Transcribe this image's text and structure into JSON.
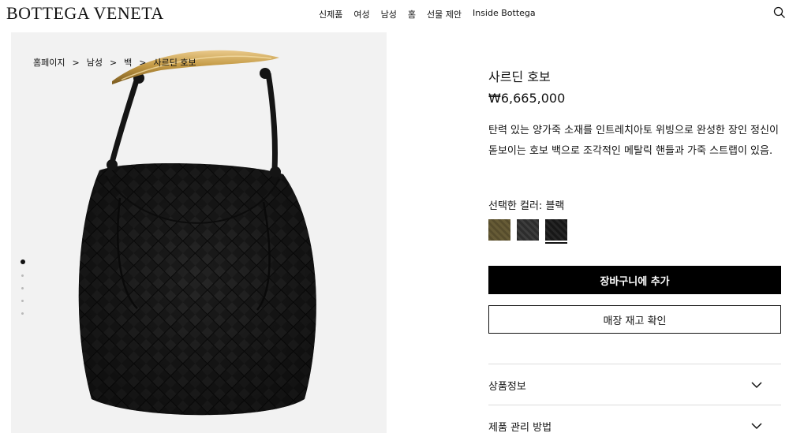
{
  "header": {
    "logo": "BOTTEGA VENETA",
    "nav": [
      "신제품",
      "여성",
      "남성",
      "홈",
      "선물 제안",
      "Inside Bottega"
    ],
    "search_icon": "search-icon"
  },
  "breadcrumb": [
    "홈페이지",
    "남성",
    "백",
    "사르딘 호보"
  ],
  "breadcrumb_separator": ">",
  "gallery": {
    "image_count": 5,
    "active_index": 0
  },
  "product": {
    "title": "사르딘 호보",
    "price": "₩6,665,000",
    "description": "탄력 있는 양가죽 소재를 인트레치아토 위빙으로 완성한 장인 정신이 돋보이는 호보 백으로 조각적인 메탈릭 핸들과 가죽 스트랩이 있음.",
    "color_label": "선택한 컬러: 블랙",
    "swatches": [
      {
        "name": "olive",
        "color": "#9a9170"
      },
      {
        "name": "dark-grey",
        "color": "#333333"
      },
      {
        "name": "black",
        "color": "#1c1c1c",
        "selected": true
      }
    ],
    "add_to_cart": "장바구니에 추가",
    "check_stock": "매장 재고 확인"
  },
  "accordion": [
    "상품정보",
    "제품 관리 방법"
  ],
  "colors": {
    "accent": "#000000",
    "panel_bg": "#f2f2f2",
    "divider": "#dcdcdc"
  }
}
